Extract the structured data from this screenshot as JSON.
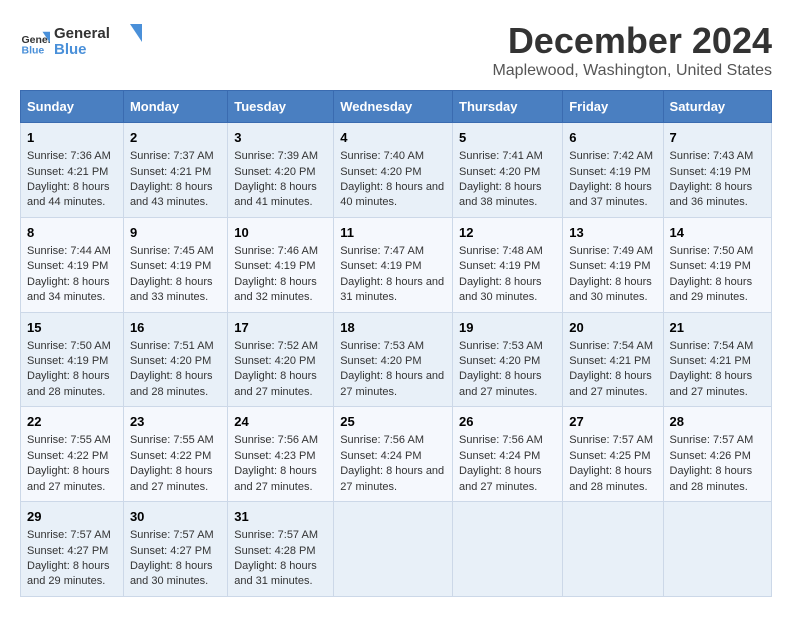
{
  "logo": {
    "line1": "General",
    "line2": "Blue"
  },
  "title": "December 2024",
  "subtitle": "Maplewood, Washington, United States",
  "days_of_week": [
    "Sunday",
    "Monday",
    "Tuesday",
    "Wednesday",
    "Thursday",
    "Friday",
    "Saturday"
  ],
  "weeks": [
    [
      {
        "day": "1",
        "sunrise": "7:36 AM",
        "sunset": "4:21 PM",
        "daylight": "8 hours and 44 minutes."
      },
      {
        "day": "2",
        "sunrise": "7:37 AM",
        "sunset": "4:21 PM",
        "daylight": "8 hours and 43 minutes."
      },
      {
        "day": "3",
        "sunrise": "7:39 AM",
        "sunset": "4:20 PM",
        "daylight": "8 hours and 41 minutes."
      },
      {
        "day": "4",
        "sunrise": "7:40 AM",
        "sunset": "4:20 PM",
        "daylight": "8 hours and 40 minutes."
      },
      {
        "day": "5",
        "sunrise": "7:41 AM",
        "sunset": "4:20 PM",
        "daylight": "8 hours and 38 minutes."
      },
      {
        "day": "6",
        "sunrise": "7:42 AM",
        "sunset": "4:19 PM",
        "daylight": "8 hours and 37 minutes."
      },
      {
        "day": "7",
        "sunrise": "7:43 AM",
        "sunset": "4:19 PM",
        "daylight": "8 hours and 36 minutes."
      }
    ],
    [
      {
        "day": "8",
        "sunrise": "7:44 AM",
        "sunset": "4:19 PM",
        "daylight": "8 hours and 34 minutes."
      },
      {
        "day": "9",
        "sunrise": "7:45 AM",
        "sunset": "4:19 PM",
        "daylight": "8 hours and 33 minutes."
      },
      {
        "day": "10",
        "sunrise": "7:46 AM",
        "sunset": "4:19 PM",
        "daylight": "8 hours and 32 minutes."
      },
      {
        "day": "11",
        "sunrise": "7:47 AM",
        "sunset": "4:19 PM",
        "daylight": "8 hours and 31 minutes."
      },
      {
        "day": "12",
        "sunrise": "7:48 AM",
        "sunset": "4:19 PM",
        "daylight": "8 hours and 30 minutes."
      },
      {
        "day": "13",
        "sunrise": "7:49 AM",
        "sunset": "4:19 PM",
        "daylight": "8 hours and 30 minutes."
      },
      {
        "day": "14",
        "sunrise": "7:50 AM",
        "sunset": "4:19 PM",
        "daylight": "8 hours and 29 minutes."
      }
    ],
    [
      {
        "day": "15",
        "sunrise": "7:50 AM",
        "sunset": "4:19 PM",
        "daylight": "8 hours and 28 minutes."
      },
      {
        "day": "16",
        "sunrise": "7:51 AM",
        "sunset": "4:20 PM",
        "daylight": "8 hours and 28 minutes."
      },
      {
        "day": "17",
        "sunrise": "7:52 AM",
        "sunset": "4:20 PM",
        "daylight": "8 hours and 27 minutes."
      },
      {
        "day": "18",
        "sunrise": "7:53 AM",
        "sunset": "4:20 PM",
        "daylight": "8 hours and 27 minutes."
      },
      {
        "day": "19",
        "sunrise": "7:53 AM",
        "sunset": "4:20 PM",
        "daylight": "8 hours and 27 minutes."
      },
      {
        "day": "20",
        "sunrise": "7:54 AM",
        "sunset": "4:21 PM",
        "daylight": "8 hours and 27 minutes."
      },
      {
        "day": "21",
        "sunrise": "7:54 AM",
        "sunset": "4:21 PM",
        "daylight": "8 hours and 27 minutes."
      }
    ],
    [
      {
        "day": "22",
        "sunrise": "7:55 AM",
        "sunset": "4:22 PM",
        "daylight": "8 hours and 27 minutes."
      },
      {
        "day": "23",
        "sunrise": "7:55 AM",
        "sunset": "4:22 PM",
        "daylight": "8 hours and 27 minutes."
      },
      {
        "day": "24",
        "sunrise": "7:56 AM",
        "sunset": "4:23 PM",
        "daylight": "8 hours and 27 minutes."
      },
      {
        "day": "25",
        "sunrise": "7:56 AM",
        "sunset": "4:24 PM",
        "daylight": "8 hours and 27 minutes."
      },
      {
        "day": "26",
        "sunrise": "7:56 AM",
        "sunset": "4:24 PM",
        "daylight": "8 hours and 27 minutes."
      },
      {
        "day": "27",
        "sunrise": "7:57 AM",
        "sunset": "4:25 PM",
        "daylight": "8 hours and 28 minutes."
      },
      {
        "day": "28",
        "sunrise": "7:57 AM",
        "sunset": "4:26 PM",
        "daylight": "8 hours and 28 minutes."
      }
    ],
    [
      {
        "day": "29",
        "sunrise": "7:57 AM",
        "sunset": "4:27 PM",
        "daylight": "8 hours and 29 minutes."
      },
      {
        "day": "30",
        "sunrise": "7:57 AM",
        "sunset": "4:27 PM",
        "daylight": "8 hours and 30 minutes."
      },
      {
        "day": "31",
        "sunrise": "7:57 AM",
        "sunset": "4:28 PM",
        "daylight": "8 hours and 31 minutes."
      },
      {
        "day": "",
        "sunrise": "",
        "sunset": "",
        "daylight": ""
      },
      {
        "day": "",
        "sunrise": "",
        "sunset": "",
        "daylight": ""
      },
      {
        "day": "",
        "sunrise": "",
        "sunset": "",
        "daylight": ""
      },
      {
        "day": "",
        "sunrise": "",
        "sunset": "",
        "daylight": ""
      }
    ]
  ],
  "labels": {
    "sunrise_prefix": "Sunrise: ",
    "sunset_prefix": "Sunset: ",
    "daylight_prefix": "Daylight: "
  }
}
